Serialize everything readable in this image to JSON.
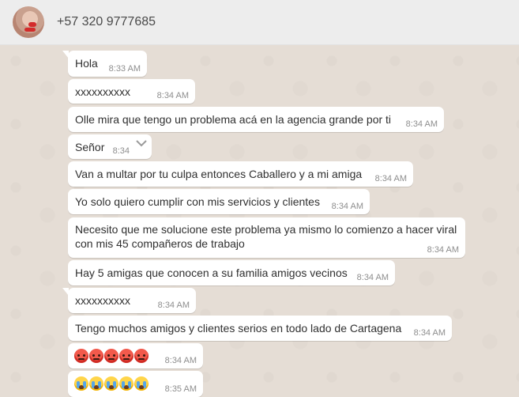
{
  "header": {
    "contact_name": "+57 320 9777685"
  },
  "messages": [
    {
      "text": "Hola",
      "time": "8:33 AM"
    },
    {
      "text": "xxxxxxxxxx",
      "time": "8:34 AM"
    },
    {
      "text": "Olle mira que tengo un problema acá en la agencia grande por ti",
      "time": "8:34 AM"
    },
    {
      "text": "Señor",
      "time": "8:34"
    },
    {
      "text": "Van a multar por tu culpa entonces Caballero y a mi amiga",
      "time": "8:34 AM"
    },
    {
      "text": "Yo solo quiero cumplir con mis servicios y clientes",
      "time": "8:34 AM"
    },
    {
      "text": "Necesito que me solucione este problema ya mismo lo comienzo a hacer viral con mis 45 compañeros de trabajo",
      "time": "8:34 AM"
    },
    {
      "text": "Hay 5 amigas que conocen a su familia amigos vecinos",
      "time": "8:34 AM"
    },
    {
      "text": "xxxxxxxxxx",
      "time": "8:34 AM"
    },
    {
      "text": "Tengo muchos amigos y clientes serios en todo lado de Cartagena",
      "time": "8:34 AM"
    },
    {
      "emoji": "angry-face x5",
      "time": "8:34 AM"
    },
    {
      "emoji": "crying-face x5",
      "time": "8:35 AM"
    }
  ],
  "colors": {
    "chat_bg": "#e5ddd5",
    "header_bg": "#ededed",
    "bubble": "#ffffff",
    "time": "#8e8e8e"
  }
}
